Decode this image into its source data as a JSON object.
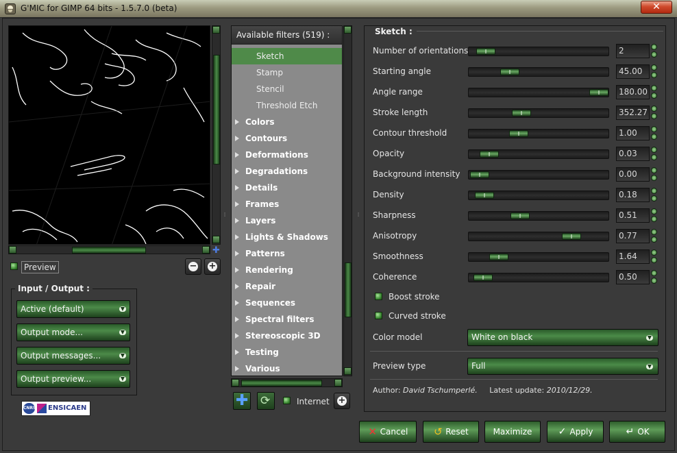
{
  "window": {
    "title": "G'MIC for GIMP 64 bits - 1.5.7.0 (beta)",
    "close_label": "✕"
  },
  "preview": {
    "checkbox_label": "Preview",
    "zoom_out": "−",
    "zoom_in": "+"
  },
  "io": {
    "title": "Input / Output :",
    "combos": [
      "Active (default)",
      "Output mode...",
      "Output messages...",
      "Output preview..."
    ]
  },
  "logo": {
    "text": "ENSICAEN",
    "badge": "CNRS"
  },
  "filters": {
    "header": "Available filters (519) :",
    "sub_items": [
      "Sketch",
      "Stamp",
      "Stencil",
      "Threshold Etch"
    ],
    "selected": "Sketch",
    "categories": [
      "Colors",
      "Contours",
      "Deformations",
      "Degradations",
      "Details",
      "Frames",
      "Layers",
      "Lights & Shadows",
      "Patterns",
      "Rendering",
      "Repair",
      "Sequences",
      "Spectral filters",
      "Stereoscopic 3D",
      "Testing",
      "Various"
    ],
    "internet_label": "Internet"
  },
  "sketch": {
    "title": "Sketch :",
    "params": [
      {
        "label": "Number of orientations",
        "value": "2",
        "fraction": 0.05
      },
      {
        "label": "Starting angle",
        "value": "45.00",
        "fraction": 0.25
      },
      {
        "label": "Angle range",
        "value": "180.00",
        "fraction": 1.0
      },
      {
        "label": "Stroke length",
        "value": "352.27",
        "fraction": 0.35
      },
      {
        "label": "Contour threshold",
        "value": "1.00",
        "fraction": 0.33
      },
      {
        "label": "Opacity",
        "value": "0.03",
        "fraction": 0.08
      },
      {
        "label": "Background intensity",
        "value": "0.00",
        "fraction": 0.0
      },
      {
        "label": "Density",
        "value": "0.18",
        "fraction": 0.04
      },
      {
        "label": "Sharpness",
        "value": "0.51",
        "fraction": 0.34
      },
      {
        "label": "Anisotropy",
        "value": "0.77",
        "fraction": 0.77
      },
      {
        "label": "Smoothness",
        "value": "1.64",
        "fraction": 0.16
      },
      {
        "label": "Coherence",
        "value": "0.50",
        "fraction": 0.03
      }
    ],
    "checkboxes": [
      "Boost stroke",
      "Curved stroke"
    ],
    "color_model_label": "Color model",
    "color_model_value": "White on black",
    "preview_type_label": "Preview type",
    "preview_type_value": "Full",
    "author_label": "Author:",
    "author_name": "David Tschumperlé.",
    "update_label": "Latest update:",
    "update_date": "2010/12/29."
  },
  "buttons": {
    "cancel": "Cancel",
    "reset": "Reset",
    "maximize": "Maximize",
    "apply": "Apply",
    "ok": "OK"
  },
  "colors": {
    "accent": "#4f8a49",
    "panel": "#3a3a3a",
    "list_bg": "#8a8a8a"
  }
}
